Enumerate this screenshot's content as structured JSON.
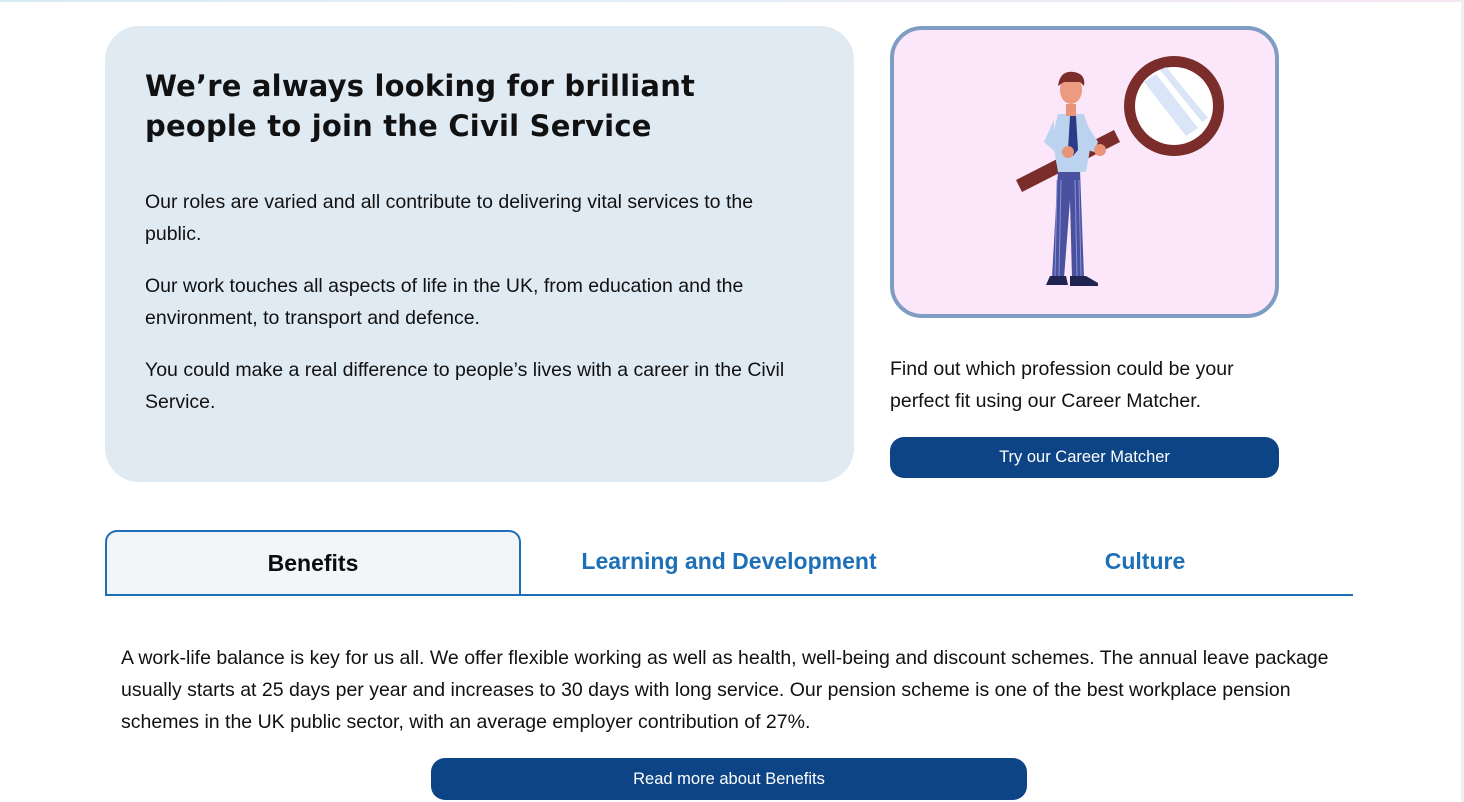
{
  "intro": {
    "title": "We’re always looking for brilliant people to join the Civil Service",
    "paragraphs": [
      "Our roles are varied and all contribute to delivering vital services to the public.",
      "Our work touches all aspects of life in the UK, from education and the environment, to transport and defence.",
      "You could make a real difference to people’s lives with a career in the Civil Service."
    ]
  },
  "career_matcher": {
    "illustration_icon": "person-with-magnifying-glass",
    "text": "Find out which profession could be your perfect fit using our Career Matcher.",
    "button_label": "Try our Career Matcher"
  },
  "tabs": {
    "items": [
      {
        "label": "Benefits",
        "active": true
      },
      {
        "label": "Learning and Development",
        "active": false
      },
      {
        "label": "Culture",
        "active": false
      }
    ]
  },
  "benefits_panel": {
    "text": "A work-life balance is key for us all. We offer flexible working as well as health, well-being and discount schemes. The annual leave package usually starts at 25 days per year and increases to 30 days with long service. Our pension scheme is one of the best workplace pension schemes in the UK public sector, with an average employer contribution of 27%.",
    "button_label": "Read more about Benefits"
  },
  "colors": {
    "brand_blue": "#0c4486",
    "link_blue": "#1d70b8",
    "intro_card_bg": "#dfeaf3",
    "illustration_bg": "#fbe6fa"
  }
}
